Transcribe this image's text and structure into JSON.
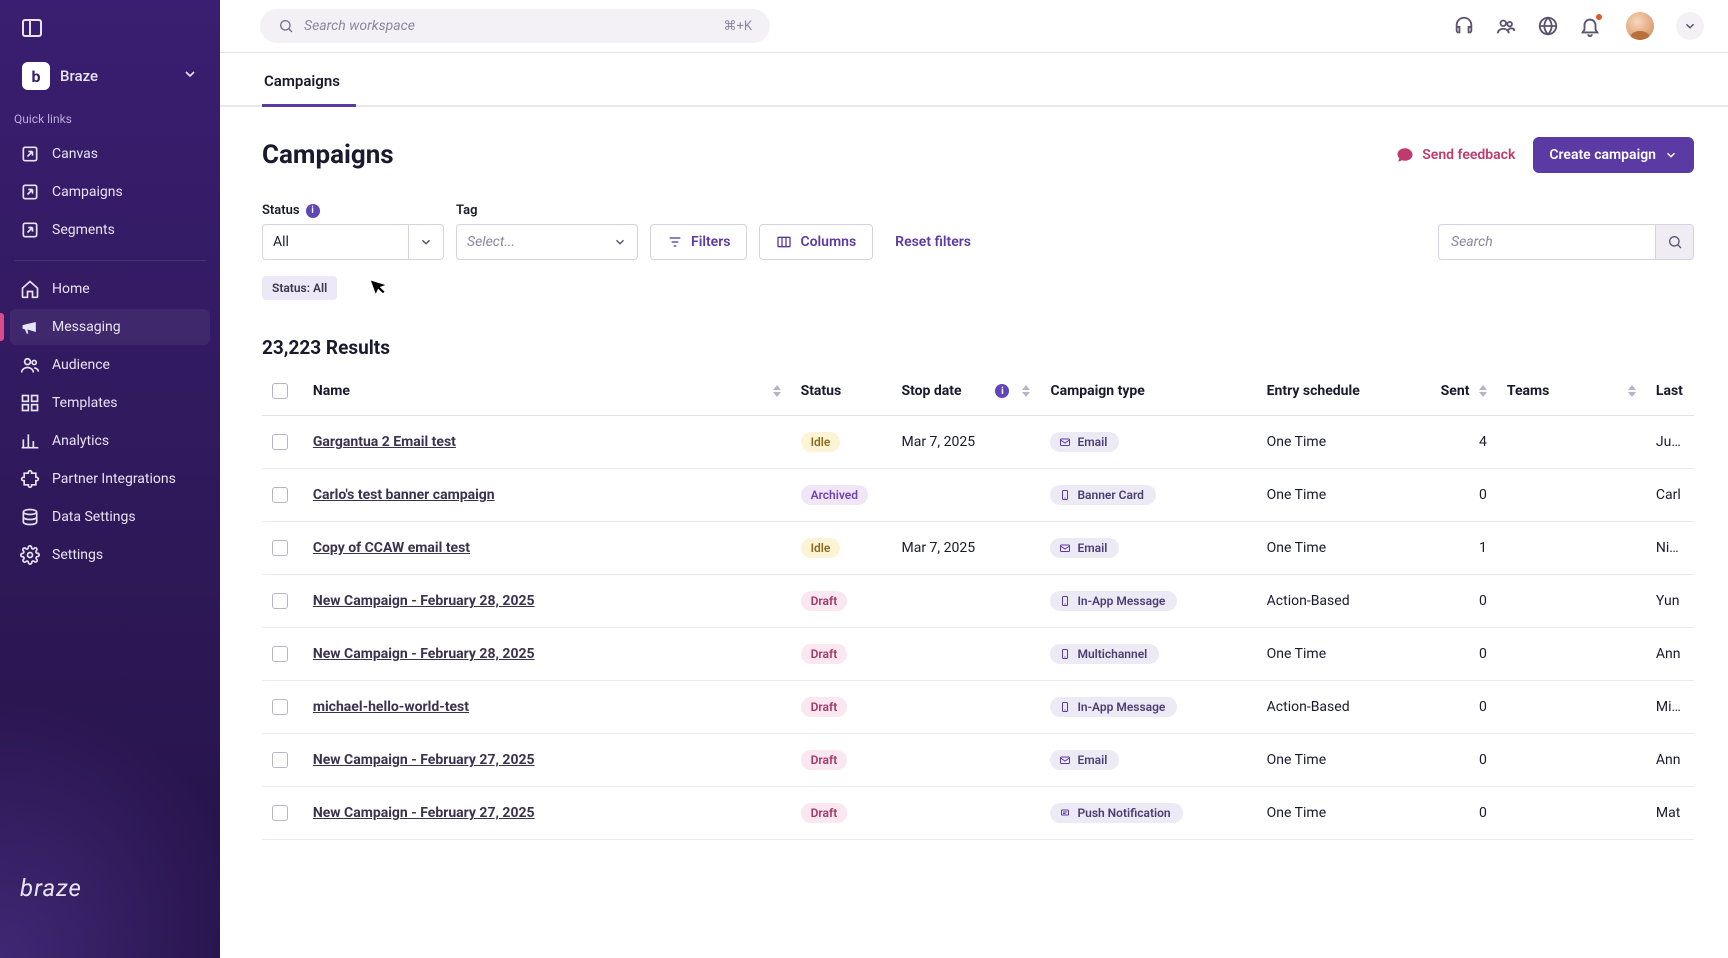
{
  "sidebar": {
    "workspace_initial": "b",
    "workspace_name": "Braze",
    "quick_links_header": "Quick links",
    "quick_links": [
      {
        "label": "Canvas"
      },
      {
        "label": "Campaigns"
      },
      {
        "label": "Segments"
      }
    ],
    "main_nav": [
      {
        "label": "Home"
      },
      {
        "label": "Messaging"
      },
      {
        "label": "Audience"
      },
      {
        "label": "Templates"
      },
      {
        "label": "Analytics"
      },
      {
        "label": "Partner Integrations"
      },
      {
        "label": "Data Settings"
      },
      {
        "label": "Settings"
      }
    ],
    "brand": "braze"
  },
  "topbar": {
    "search_placeholder": "Search workspace",
    "search_shortcut": "⌘+K"
  },
  "tabs": {
    "campaigns": "Campaigns"
  },
  "page": {
    "title": "Campaigns",
    "feedback": "Send feedback",
    "create_btn": "Create campaign"
  },
  "filters": {
    "status_label": "Status",
    "status_value": "All",
    "tag_label": "Tag",
    "tag_placeholder": "Select...",
    "filters_btn": "Filters",
    "columns_btn": "Columns",
    "reset_btn": "Reset filters",
    "search_placeholder": "Search",
    "chip_status": "Status: All"
  },
  "results": {
    "count_label": "23,223 Results"
  },
  "table": {
    "headers": {
      "name": "Name",
      "status": "Status",
      "stop_date": "Stop date",
      "campaign_type": "Campaign type",
      "entry_schedule": "Entry schedule",
      "sent": "Sent",
      "teams": "Teams",
      "last": "Last"
    },
    "rows": [
      {
        "name": "Gargantua 2 Email test",
        "status": "Idle",
        "status_class": "idle",
        "stop_date": "Mar 7, 2025",
        "type": "Email",
        "type_icon": "mail",
        "schedule": "One Time",
        "sent": "4",
        "teams": "",
        "last": "Julia"
      },
      {
        "name": "Carlo's test banner campaign",
        "status": "Archived",
        "status_class": "archived",
        "stop_date": "",
        "type": "Banner Card",
        "type_icon": "device",
        "schedule": "One Time",
        "sent": "0",
        "teams": "",
        "last": "Carl"
      },
      {
        "name": "Copy of CCAW email test",
        "status": "Idle",
        "status_class": "idle",
        "stop_date": "Mar 7, 2025",
        "type": "Email",
        "type_icon": "mail",
        "schedule": "One Time",
        "sent": "1",
        "teams": "",
        "last": "Nich"
      },
      {
        "name": "New Campaign - February 28, 2025",
        "status": "Draft",
        "status_class": "draft",
        "stop_date": "",
        "type": "In-App Message",
        "type_icon": "device",
        "schedule": "Action-Based",
        "sent": "0",
        "teams": "",
        "last": "Yun"
      },
      {
        "name": "New Campaign - February 28, 2025",
        "status": "Draft",
        "status_class": "draft",
        "stop_date": "",
        "type": "Multichannel",
        "type_icon": "device",
        "schedule": "One Time",
        "sent": "0",
        "teams": "",
        "last": "Ann"
      },
      {
        "name": "michael-hello-world-test",
        "status": "Draft",
        "status_class": "draft",
        "stop_date": "",
        "type": "In-App Message",
        "type_icon": "device",
        "schedule": "Action-Based",
        "sent": "0",
        "teams": "",
        "last": "Mich"
      },
      {
        "name": "New Campaign - February 27, 2025",
        "status": "Draft",
        "status_class": "draft",
        "stop_date": "",
        "type": "Email",
        "type_icon": "mail",
        "schedule": "One Time",
        "sent": "0",
        "teams": "",
        "last": "Ann"
      },
      {
        "name": "New Campaign - February 27, 2025",
        "status": "Draft",
        "status_class": "draft",
        "stop_date": "",
        "type": "Push Notification",
        "type_icon": "push",
        "schedule": "One Time",
        "sent": "0",
        "teams": "",
        "last": "Mat"
      }
    ]
  }
}
